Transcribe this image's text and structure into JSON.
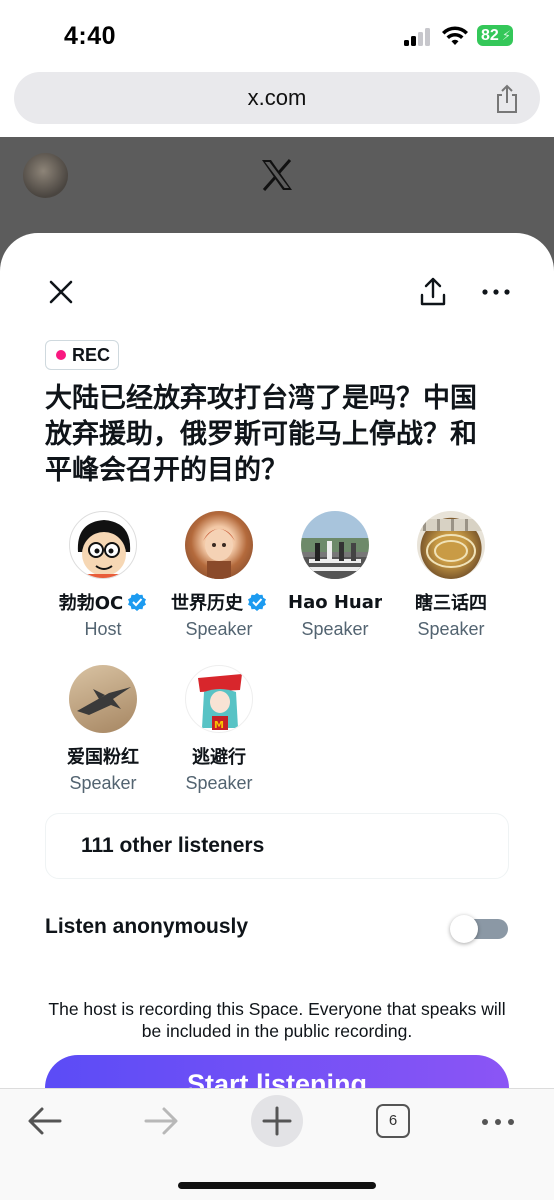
{
  "status_bar": {
    "time": "4:40",
    "battery": "82"
  },
  "browser": {
    "url": "x.com",
    "tab_count": "6"
  },
  "space": {
    "rec_label": "REC",
    "title": "大陆已经放弃攻打台湾了是吗？中国放弃援助，俄罗斯可能马上停战？和平峰会召开的目的？",
    "participants": [
      {
        "name": "勃勃OC",
        "role": "Host",
        "verified": true
      },
      {
        "name": "世界历史",
        "role": "Speaker",
        "verified": true
      },
      {
        "name": "Hao Huang",
        "role": "Speaker",
        "verified": false
      },
      {
        "name": "瞎三话四",
        "role": "Speaker",
        "verified": false
      },
      {
        "name": "爱国粉红",
        "role": "Speaker",
        "verified": false
      },
      {
        "name": "逃避行",
        "role": "Speaker",
        "verified": false
      }
    ],
    "listeners": "111 other listeners",
    "anonymous_label": "Listen anonymously",
    "anonymous_on": false,
    "recording_note": "The host is recording this Space. Everyone that speaks will be included in the public recording.",
    "start_button": "Start listening"
  },
  "colors": {
    "accent": "#1d9bf0",
    "rec_dot": "#f91880",
    "start_gradient_from": "#5b4cf6",
    "start_gradient_to": "#8b55f5",
    "battery": "#34c759"
  }
}
